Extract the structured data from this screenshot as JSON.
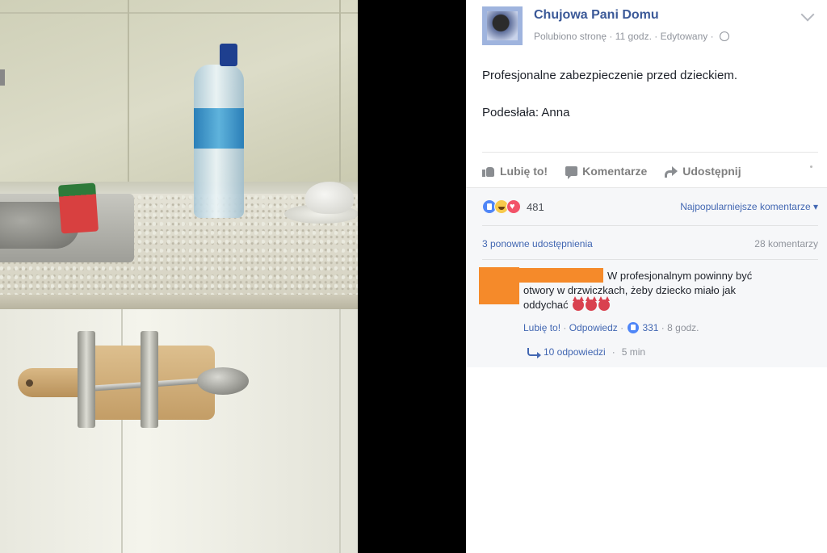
{
  "photo": {
    "alt": ""
  },
  "post": {
    "page_name": "Chujowa Pani Domu",
    "meta": {
      "liked": "Polubiono stronę",
      "time": "11 godz.",
      "edited": "Edytowany"
    },
    "text": [
      "Profesjonalne zabezpieczenie przed dzieckiem.",
      "Podesłała: Anna"
    ],
    "actions": {
      "like": "Lubię to!",
      "comment": "Komentarze",
      "share": "Udostępnij"
    },
    "icons": [
      "like-icon",
      "comment-icon",
      "share-icon",
      "globe-icon",
      "chevron-down-icon"
    ]
  },
  "feedback": {
    "reaction_count": "481",
    "reactions": [
      "like",
      "haha",
      "love"
    ],
    "sort_label": "Najpopularniejsze komentarze",
    "shares": "3 ponowne udostępnienia",
    "comments_count": "28 komentarzy"
  },
  "comment": {
    "line1": "W profesjonalnym powinny być",
    "line2": "otwory w drzwiczkach, żeby dziecko miało jak",
    "line3": "oddychać",
    "emoji": [
      "devil",
      "devil",
      "devil"
    ],
    "like_label": "Lubię to!",
    "reply_label": "Odpowiedz",
    "likes": "331",
    "time": "8 godz.",
    "replies_label": "10 odpowiedzi",
    "replies_time": "5 min"
  },
  "colors": {
    "link": "#4267b2",
    "page_name": "#3b5998",
    "redaction": "#f58a2a",
    "muted": "#90949c"
  }
}
